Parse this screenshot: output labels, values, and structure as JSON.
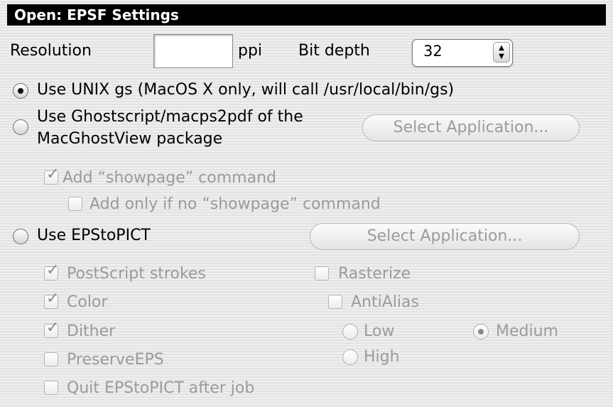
{
  "window": {
    "title": "Open: EPSF Settings"
  },
  "resolution": {
    "label": "Resolution",
    "value": "",
    "unit": "ppi"
  },
  "bit_depth": {
    "label": "Bit depth",
    "value": "32"
  },
  "options": {
    "unix_gs": {
      "label": "Use UNIX gs (MacOS X only, will call /usr/local/bin/gs)",
      "selected": true
    },
    "ghostscript": {
      "label_line1": "Use Ghostscript/macps2pdf of the",
      "label_line2": "MacGhostView package",
      "button": "Select Application..."
    },
    "add_showpage": {
      "label": "Add “showpage” command",
      "checked": true
    },
    "add_only_if_no_showpage": {
      "label": "Add only if no “showpage” command",
      "checked": false
    },
    "epstopict": {
      "label": "Use EPStoPICT",
      "button": "Select Application..."
    }
  },
  "epstopict_options": {
    "postscript_strokes": {
      "label": "PostScript strokes",
      "checked": true
    },
    "color": {
      "label": "Color",
      "checked": true
    },
    "dither": {
      "label": "Dither",
      "checked": true
    },
    "preserve_eps": {
      "label": "PreserveEPS",
      "checked": false
    },
    "quit_after_job": {
      "label": "Quit EPStoPICT after job",
      "checked": false
    },
    "rasterize": {
      "label": "Rasterize",
      "checked": false
    },
    "antialias": {
      "label": "AntiAlias",
      "checked": false
    },
    "quality_low": {
      "label": "Low",
      "selected": false
    },
    "quality_medium": {
      "label": "Medium",
      "selected": true
    },
    "quality_high": {
      "label": "High",
      "selected": false
    }
  }
}
